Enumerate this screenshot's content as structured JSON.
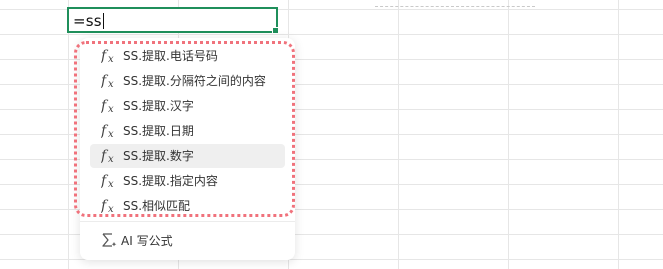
{
  "cell": {
    "formula": "=ss"
  },
  "suggestions": [
    {
      "icon": "function-icon",
      "label": "SS.提取.电话号码"
    },
    {
      "icon": "function-icon",
      "label": "SS.提取.分隔符之间的内容"
    },
    {
      "icon": "function-icon",
      "label": "SS.提取.汉字"
    },
    {
      "icon": "function-icon",
      "label": "SS.提取.日期"
    },
    {
      "icon": "function-icon",
      "label": "SS.提取.数字"
    },
    {
      "icon": "function-icon",
      "label": "SS.提取.指定内容"
    },
    {
      "icon": "function-icon",
      "label": "SS.相似匹配"
    }
  ],
  "ai_action": {
    "icon": "sigma-sparkle-icon",
    "label": "AI 写公式"
  },
  "colors": {
    "cell_border": "#1f8f5b",
    "highlight_dots": "#f0727c",
    "active_item": "#efefef"
  }
}
